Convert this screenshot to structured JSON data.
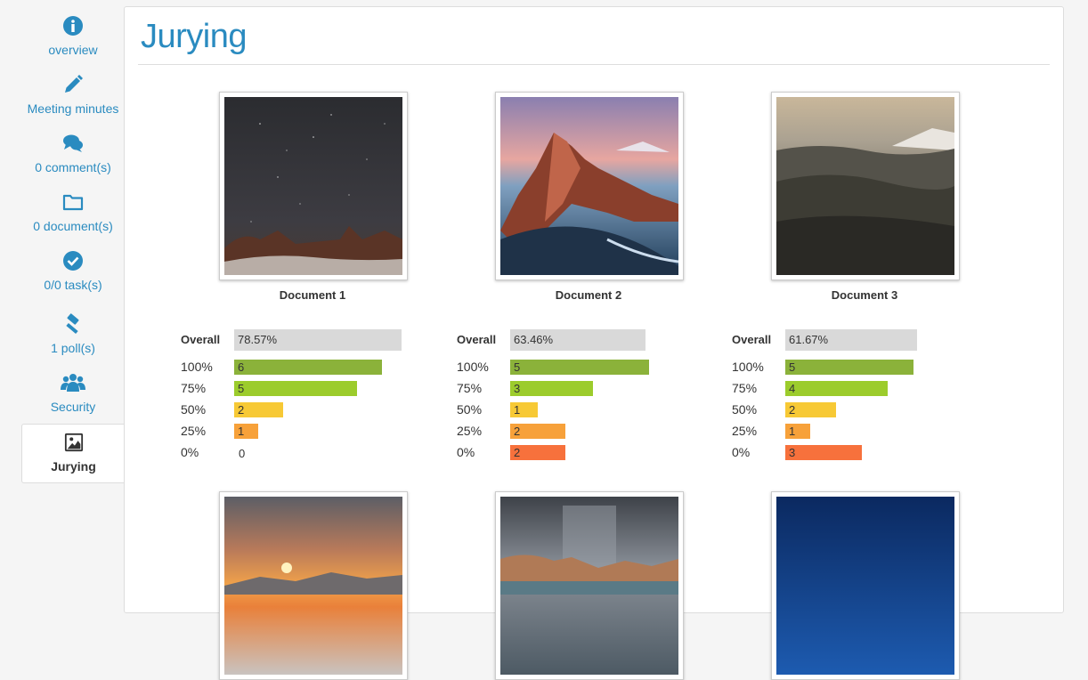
{
  "sidebar": {
    "items": [
      {
        "label": "overview",
        "icon": "info-circle-icon"
      },
      {
        "label": "Meeting minutes",
        "icon": "pencil-icon"
      },
      {
        "label": "0 comment(s)",
        "icon": "comments-icon"
      },
      {
        "label": "0 document(s)",
        "icon": "folder-icon"
      },
      {
        "label": "0/0 task(s)",
        "icon": "check-circle-icon"
      },
      {
        "label": "1 poll(s)",
        "icon": "gavel-icon"
      },
      {
        "label": "Security",
        "icon": "users-icon"
      },
      {
        "label": "Jurying",
        "icon": "image-icon",
        "active": true
      }
    ]
  },
  "main": {
    "title": "Jurying",
    "documents": [
      {
        "name": "Document 1",
        "overall_label": "Overall",
        "overall": "78.57%",
        "rows": [
          {
            "label": "100%",
            "count": "6",
            "max_fraction": 1.0
          },
          {
            "label": "75%",
            "count": "5",
            "max_fraction": 0.83
          },
          {
            "label": "50%",
            "count": "2",
            "max_fraction": 0.33
          },
          {
            "label": "25%",
            "count": "1",
            "max_fraction": 0.17
          },
          {
            "label": "0%",
            "count": "0",
            "max_fraction": 0
          }
        ]
      },
      {
        "name": "Document 2",
        "overall_label": "Overall",
        "overall": "63.46%",
        "rows": [
          {
            "label": "100%",
            "count": "5",
            "max_fraction": 1.0
          },
          {
            "label": "75%",
            "count": "3",
            "max_fraction": 0.6
          },
          {
            "label": "50%",
            "count": "1",
            "max_fraction": 0.2
          },
          {
            "label": "25%",
            "count": "2",
            "max_fraction": 0.4
          },
          {
            "label": "0%",
            "count": "2",
            "max_fraction": 0.4
          }
        ]
      },
      {
        "name": "Document 3",
        "overall_label": "Overall",
        "overall": "61.67%",
        "rows": [
          {
            "label": "100%",
            "count": "5",
            "max_fraction": 1.0
          },
          {
            "label": "75%",
            "count": "4",
            "max_fraction": 0.8
          },
          {
            "label": "50%",
            "count": "2",
            "max_fraction": 0.4
          },
          {
            "label": "25%",
            "count": "1",
            "max_fraction": 0.2
          },
          {
            "label": "0%",
            "count": "3",
            "max_fraction": 0.6
          }
        ]
      }
    ]
  },
  "colors": {
    "accent": "#2a8bc0",
    "bar_100": "#8bb23a",
    "bar_75": "#9ccc2c",
    "bar_50": "#f7c935",
    "bar_25": "#f7a13a",
    "bar_0": "#f7713c",
    "overall_bg": "#d9d9d9"
  }
}
